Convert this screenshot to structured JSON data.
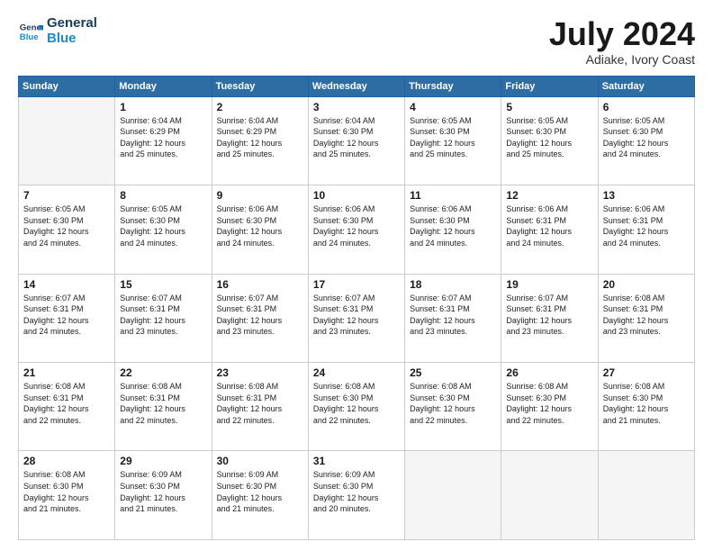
{
  "header": {
    "logo_line1": "General",
    "logo_line2": "Blue",
    "month_year": "July 2024",
    "location": "Adiake, Ivory Coast"
  },
  "days_of_week": [
    "Sunday",
    "Monday",
    "Tuesday",
    "Wednesday",
    "Thursday",
    "Friday",
    "Saturday"
  ],
  "weeks": [
    [
      {
        "day": "",
        "text": ""
      },
      {
        "day": "1",
        "text": "Sunrise: 6:04 AM\nSunset: 6:29 PM\nDaylight: 12 hours\nand 25 minutes."
      },
      {
        "day": "2",
        "text": "Sunrise: 6:04 AM\nSunset: 6:29 PM\nDaylight: 12 hours\nand 25 minutes."
      },
      {
        "day": "3",
        "text": "Sunrise: 6:04 AM\nSunset: 6:30 PM\nDaylight: 12 hours\nand 25 minutes."
      },
      {
        "day": "4",
        "text": "Sunrise: 6:05 AM\nSunset: 6:30 PM\nDaylight: 12 hours\nand 25 minutes."
      },
      {
        "day": "5",
        "text": "Sunrise: 6:05 AM\nSunset: 6:30 PM\nDaylight: 12 hours\nand 25 minutes."
      },
      {
        "day": "6",
        "text": "Sunrise: 6:05 AM\nSunset: 6:30 PM\nDaylight: 12 hours\nand 24 minutes."
      }
    ],
    [
      {
        "day": "7",
        "text": "Sunrise: 6:05 AM\nSunset: 6:30 PM\nDaylight: 12 hours\nand 24 minutes."
      },
      {
        "day": "8",
        "text": "Sunrise: 6:05 AM\nSunset: 6:30 PM\nDaylight: 12 hours\nand 24 minutes."
      },
      {
        "day": "9",
        "text": "Sunrise: 6:06 AM\nSunset: 6:30 PM\nDaylight: 12 hours\nand 24 minutes."
      },
      {
        "day": "10",
        "text": "Sunrise: 6:06 AM\nSunset: 6:30 PM\nDaylight: 12 hours\nand 24 minutes."
      },
      {
        "day": "11",
        "text": "Sunrise: 6:06 AM\nSunset: 6:30 PM\nDaylight: 12 hours\nand 24 minutes."
      },
      {
        "day": "12",
        "text": "Sunrise: 6:06 AM\nSunset: 6:31 PM\nDaylight: 12 hours\nand 24 minutes."
      },
      {
        "day": "13",
        "text": "Sunrise: 6:06 AM\nSunset: 6:31 PM\nDaylight: 12 hours\nand 24 minutes."
      }
    ],
    [
      {
        "day": "14",
        "text": "Sunrise: 6:07 AM\nSunset: 6:31 PM\nDaylight: 12 hours\nand 24 minutes."
      },
      {
        "day": "15",
        "text": "Sunrise: 6:07 AM\nSunset: 6:31 PM\nDaylight: 12 hours\nand 23 minutes."
      },
      {
        "day": "16",
        "text": "Sunrise: 6:07 AM\nSunset: 6:31 PM\nDaylight: 12 hours\nand 23 minutes."
      },
      {
        "day": "17",
        "text": "Sunrise: 6:07 AM\nSunset: 6:31 PM\nDaylight: 12 hours\nand 23 minutes."
      },
      {
        "day": "18",
        "text": "Sunrise: 6:07 AM\nSunset: 6:31 PM\nDaylight: 12 hours\nand 23 minutes."
      },
      {
        "day": "19",
        "text": "Sunrise: 6:07 AM\nSunset: 6:31 PM\nDaylight: 12 hours\nand 23 minutes."
      },
      {
        "day": "20",
        "text": "Sunrise: 6:08 AM\nSunset: 6:31 PM\nDaylight: 12 hours\nand 23 minutes."
      }
    ],
    [
      {
        "day": "21",
        "text": "Sunrise: 6:08 AM\nSunset: 6:31 PM\nDaylight: 12 hours\nand 22 minutes."
      },
      {
        "day": "22",
        "text": "Sunrise: 6:08 AM\nSunset: 6:31 PM\nDaylight: 12 hours\nand 22 minutes."
      },
      {
        "day": "23",
        "text": "Sunrise: 6:08 AM\nSunset: 6:31 PM\nDaylight: 12 hours\nand 22 minutes."
      },
      {
        "day": "24",
        "text": "Sunrise: 6:08 AM\nSunset: 6:30 PM\nDaylight: 12 hours\nand 22 minutes."
      },
      {
        "day": "25",
        "text": "Sunrise: 6:08 AM\nSunset: 6:30 PM\nDaylight: 12 hours\nand 22 minutes."
      },
      {
        "day": "26",
        "text": "Sunrise: 6:08 AM\nSunset: 6:30 PM\nDaylight: 12 hours\nand 22 minutes."
      },
      {
        "day": "27",
        "text": "Sunrise: 6:08 AM\nSunset: 6:30 PM\nDaylight: 12 hours\nand 21 minutes."
      }
    ],
    [
      {
        "day": "28",
        "text": "Sunrise: 6:08 AM\nSunset: 6:30 PM\nDaylight: 12 hours\nand 21 minutes."
      },
      {
        "day": "29",
        "text": "Sunrise: 6:09 AM\nSunset: 6:30 PM\nDaylight: 12 hours\nand 21 minutes."
      },
      {
        "day": "30",
        "text": "Sunrise: 6:09 AM\nSunset: 6:30 PM\nDaylight: 12 hours\nand 21 minutes."
      },
      {
        "day": "31",
        "text": "Sunrise: 6:09 AM\nSunset: 6:30 PM\nDaylight: 12 hours\nand 20 minutes."
      },
      {
        "day": "",
        "text": ""
      },
      {
        "day": "",
        "text": ""
      },
      {
        "day": "",
        "text": ""
      }
    ]
  ]
}
